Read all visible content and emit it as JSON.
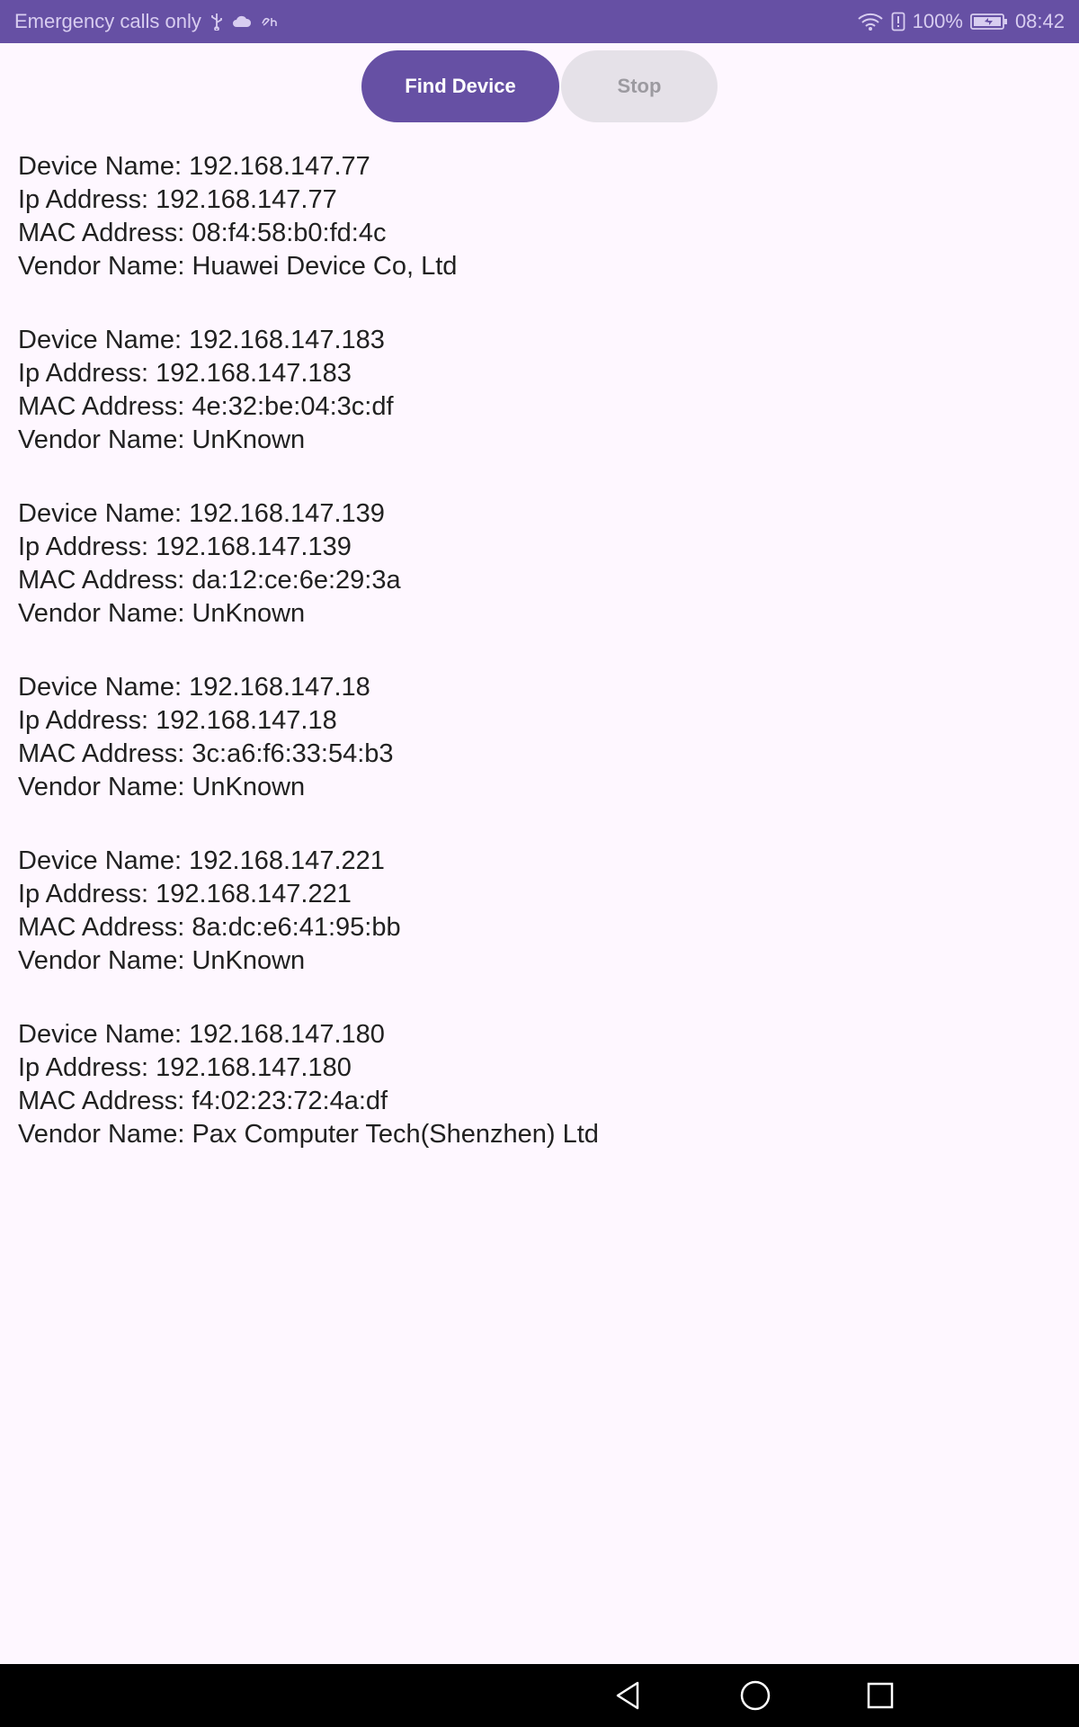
{
  "status_bar": {
    "carrier_text": "Emergency calls only",
    "battery_percent": "100%",
    "time": "08:42",
    "icons": [
      "usb-icon",
      "cloud-icon",
      "data-icon",
      "wifi-icon",
      "alert-icon",
      "battery-icon"
    ]
  },
  "buttons": {
    "find_label": "Find Device",
    "stop_label": "Stop"
  },
  "colors": {
    "primary": "#6650a4",
    "background": "#fef7ff",
    "disabled_button": "#e5e1e8"
  },
  "devices": [
    {
      "device_name": "Device Name: 192.168.147.77",
      "ip_address": "Ip Address: 192.168.147.77",
      "mac_address": "MAC Address: 08:f4:58:b0:fd:4c",
      "vendor_name": "Vendor Name: Huawei Device Co, Ltd"
    },
    {
      "device_name": "Device Name: 192.168.147.183",
      "ip_address": "Ip Address: 192.168.147.183",
      "mac_address": "MAC Address: 4e:32:be:04:3c:df",
      "vendor_name": "Vendor Name: UnKnown"
    },
    {
      "device_name": "Device Name: 192.168.147.139",
      "ip_address": "Ip Address: 192.168.147.139",
      "mac_address": "MAC Address: da:12:ce:6e:29:3a",
      "vendor_name": "Vendor Name: UnKnown"
    },
    {
      "device_name": "Device Name: 192.168.147.18",
      "ip_address": "Ip Address: 192.168.147.18",
      "mac_address": "MAC Address: 3c:a6:f6:33:54:b3",
      "vendor_name": "Vendor Name: UnKnown"
    },
    {
      "device_name": "Device Name: 192.168.147.221",
      "ip_address": "Ip Address: 192.168.147.221",
      "mac_address": "MAC Address: 8a:dc:e6:41:95:bb",
      "vendor_name": "Vendor Name: UnKnown"
    },
    {
      "device_name": "Device Name: 192.168.147.180",
      "ip_address": "Ip Address: 192.168.147.180",
      "mac_address": "MAC Address: f4:02:23:72:4a:df",
      "vendor_name": "Vendor Name: Pax Computer Tech(Shenzhen) Ltd"
    }
  ],
  "nav_bar": {
    "icons": [
      "back-icon",
      "home-icon",
      "recents-icon"
    ]
  }
}
